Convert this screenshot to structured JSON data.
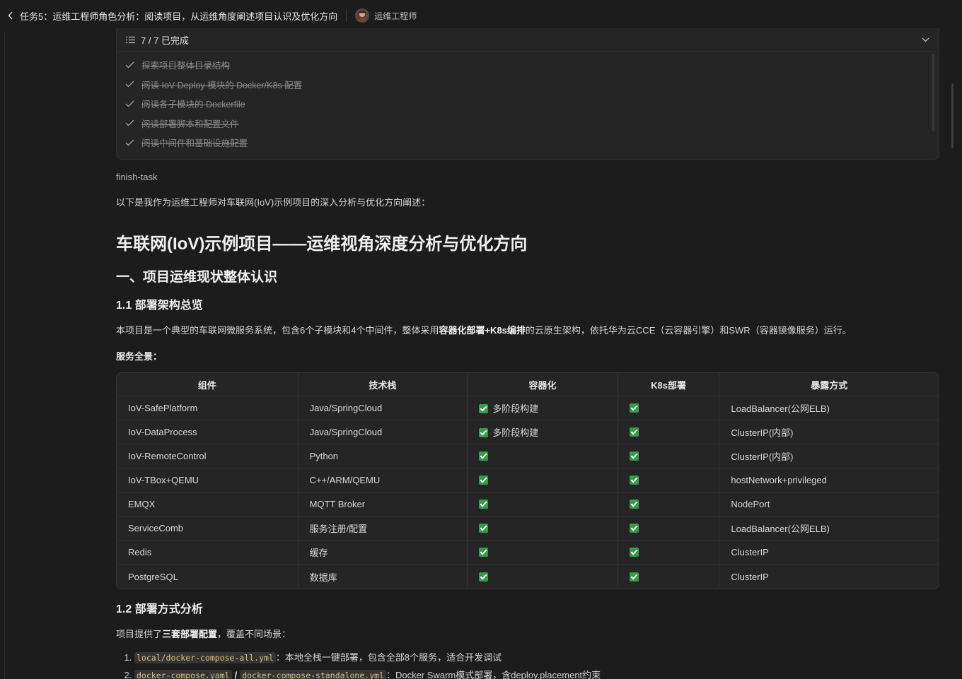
{
  "header": {
    "title": "任务5：运维工程师角色分析：阅读项目，从运维角度阐述项目认识及优化方向",
    "role": "运维工程师"
  },
  "todo": {
    "count": "7 / 7 已完成",
    "items": [
      "探索项目整体目录结构",
      "阅读 IoV-Deploy 模块的 Docker/K8s 配置",
      "阅读各子模块的 Dockerfile",
      "阅读部署脚本和配置文件",
      "阅读中间件和基础设施配置"
    ]
  },
  "content": {
    "tool_name": "finish-task",
    "intro": "以下是我作为运维工程师对车联网(IoV)示例项目的深入分析与优化方向阐述：",
    "title": "车联网(IoV)示例项目——运维视角深度分析与优化方向",
    "section1": "一、项目运维现状整体认识",
    "sub1": "1.1 部署架构总览",
    "para1_a": "本项目是一个典型的车联网微服务系统，包含6个子模块和4个中间件，整体采用",
    "para1_b": "容器化部署+K8s编排",
    "para1_c": "的云原生架构，依托华为云CCE（云容器引擎）和SWR（容器镜像服务）运行。",
    "services_label": "服务全景：",
    "sub2": "1.2 部署方式分析",
    "para2_a": "项目提供了",
    "para2_b": "三套部署配置",
    "para2_c": "，覆盖不同场景：",
    "list": [
      {
        "code1": "local/docker-compose-all.yml",
        "text": "：本地全栈一键部署，包含全部8个服务，适合开发调试"
      },
      {
        "code1": "docker-compose.yaml",
        "sep": "/",
        "code2": "docker-compose-standalone.yml",
        "text": "：Docker Swarm模式部署，含deploy.placement约束"
      }
    ]
  },
  "table": {
    "headers": [
      "组件",
      "技术栈",
      "容器化",
      "K8s部署",
      "暴露方式"
    ],
    "rows": [
      {
        "component": "IoV-SafePlatform",
        "stack": "Java/SpringCloud",
        "container_note": "多阶段构建",
        "expose": "LoadBalancer(公网ELB)"
      },
      {
        "component": "IoV-DataProcess",
        "stack": "Java/SpringCloud",
        "container_note": "多阶段构建",
        "expose": "ClusterIP(内部)"
      },
      {
        "component": "IoV-RemoteControl",
        "stack": "Python",
        "container_note": "",
        "expose": "ClusterIP(内部)"
      },
      {
        "component": "IoV-TBox+QEMU",
        "stack": "C++/ARM/QEMU",
        "container_note": "",
        "expose": "hostNetwork+privileged"
      },
      {
        "component": "EMQX",
        "stack": "MQTT Broker",
        "container_note": "",
        "expose": "NodePort"
      },
      {
        "component": "ServiceComb",
        "stack": "服务注册/配置",
        "container_note": "",
        "expose": "LoadBalancer(公网ELB)"
      },
      {
        "component": "Redis",
        "stack": "缓存",
        "container_note": "",
        "expose": "ClusterIP"
      },
      {
        "component": "PostgreSQL",
        "stack": "数据库",
        "container_note": "",
        "expose": "ClusterIP"
      }
    ]
  },
  "colors": {
    "check_green": "#2ea043",
    "code_text": "#e0c080"
  }
}
